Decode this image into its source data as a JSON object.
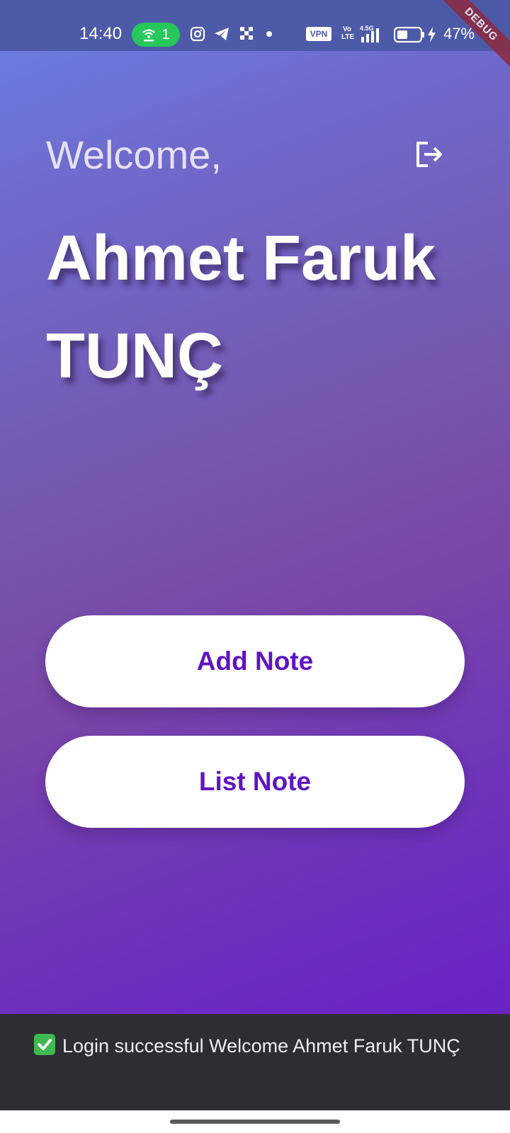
{
  "status_bar": {
    "time": "14:40",
    "hotspot_count": "1",
    "vpn": "VPN",
    "volte_top": "Vo",
    "volte_bottom": "LTE",
    "network": "4.5G",
    "battery_percent": "47%",
    "debug_banner": "DEBUG"
  },
  "greeting": {
    "welcome": "Welcome,",
    "user_name": "Ahmet Faruk TUNÇ"
  },
  "actions": {
    "add_note": "Add Note",
    "list_note": "List Note"
  },
  "snackbar": {
    "message": "Login successful Welcome Ahmet Faruk TUNÇ"
  },
  "icons": {
    "logout": "logout-icon",
    "check": "check-mark-icon"
  },
  "colors": {
    "accent_text": "#6114c2",
    "hotspot_pill": "#28c75c",
    "snackbar_bg": "#2f2d33"
  }
}
